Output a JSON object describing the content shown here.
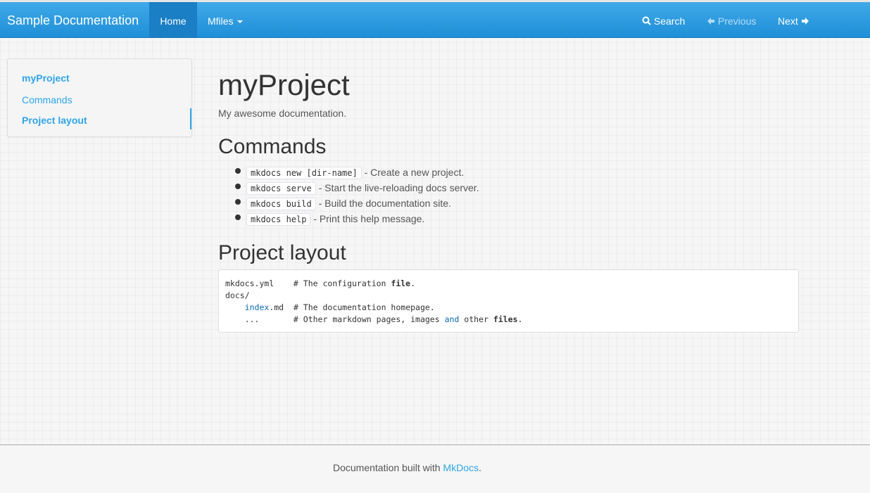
{
  "navbar": {
    "brand": "Sample Documentation",
    "home_label": "Home",
    "files_label": "Mfiles",
    "search_label": "Search",
    "previous_label": "Previous",
    "next_label": "Next"
  },
  "sidebar": {
    "items": [
      {
        "label": "myProject"
      },
      {
        "label": "Commands"
      },
      {
        "label": "Project layout"
      }
    ]
  },
  "page": {
    "title": "myProject",
    "subtitle": "My awesome documentation.",
    "commands_heading": "Commands",
    "commands": [
      {
        "code": "mkdocs new [dir-name]",
        "text": " - Create a new project."
      },
      {
        "code": "mkdocs serve",
        "text": " - Start the live-reloading docs server."
      },
      {
        "code": "mkdocs build",
        "text": " - Build the documentation site."
      },
      {
        "code": "mkdocs help",
        "text": " - Print this help message."
      }
    ],
    "layout_heading": "Project layout",
    "code": {
      "l1_a": "mkdocs.yml    # The configuration ",
      "l1_kw": "file",
      "l1_b": ".",
      "l2": "docs/",
      "l3_indent": "    ",
      "l3_link": "index",
      "l3_b": ".md  # The documentation homepage.",
      "l4_a": "    ...       # Other markdown pages, images ",
      "l4_link": "and",
      "l4_b": " other ",
      "l4_kw": "files",
      "l4_c": "."
    }
  },
  "footer": {
    "prefix": "Documentation built with ",
    "link": "MkDocs",
    "suffix": "."
  },
  "colors": {
    "accent": "#2fa4e7",
    "navbar": "#2a9de2"
  }
}
